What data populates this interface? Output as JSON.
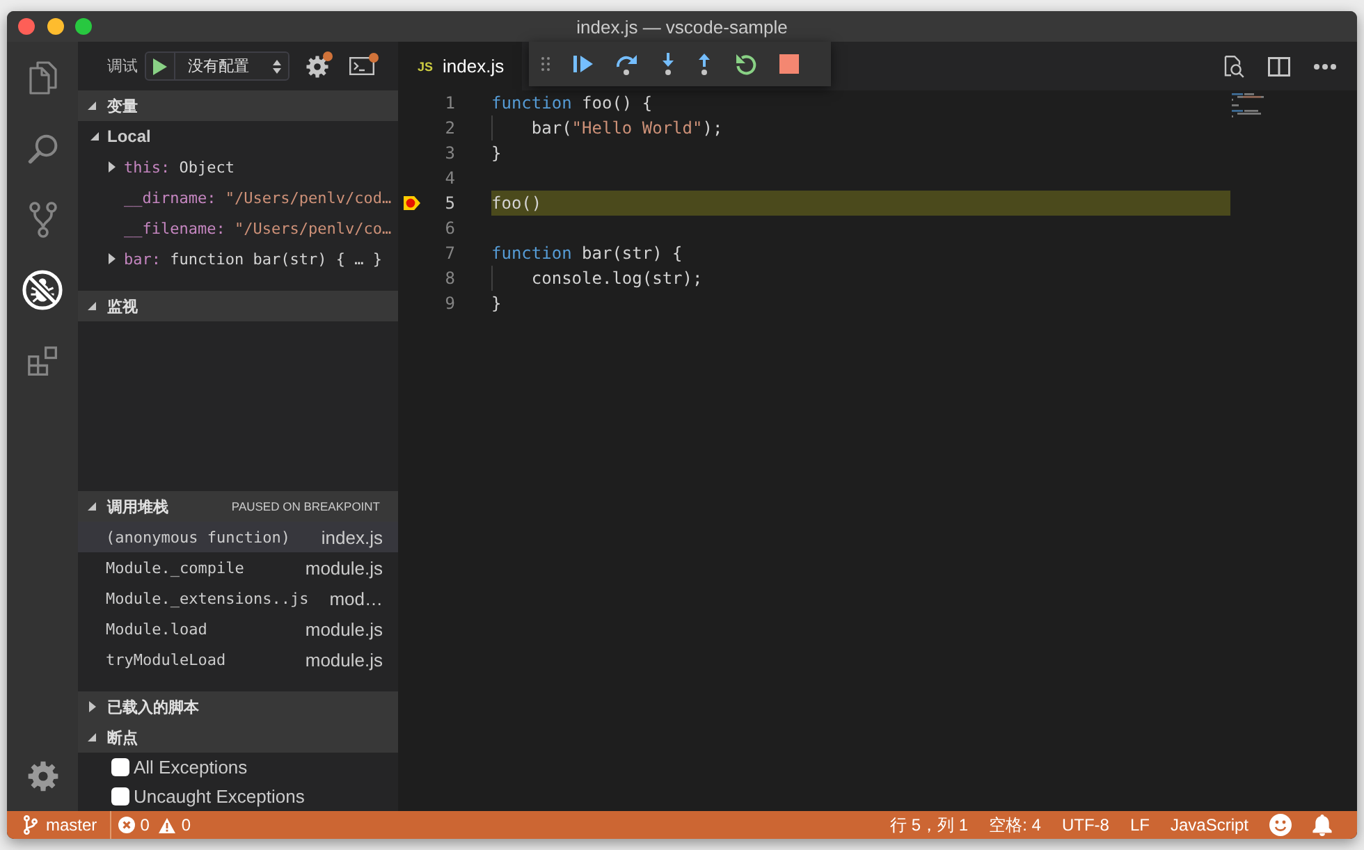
{
  "window": {
    "title": "index.js — vscode-sample"
  },
  "activity_bar": {
    "items": [
      {
        "kind": "files",
        "selected": false
      },
      {
        "kind": "search",
        "selected": false
      },
      {
        "kind": "source_control",
        "selected": false
      },
      {
        "kind": "debug",
        "selected": true
      },
      {
        "kind": "extensions",
        "selected": false
      }
    ]
  },
  "sidebar": {
    "title": "调试",
    "configuration": "没有配置",
    "sections": [
      {
        "kind": "variables",
        "title": "变量",
        "expanded": true,
        "scopes": [
          {
            "name": "Local",
            "expanded": true,
            "children": [
              {
                "kind": "object",
                "name": "this:",
                "value": "Object"
              },
              {
                "kind": "string",
                "name": "__dirname:",
                "value": "\"/Users/penlv/cod…"
              },
              {
                "kind": "string",
                "name": "__filename:",
                "value": "\"/Users/penlv/co…"
              },
              {
                "kind": "object",
                "name": "bar:",
                "value": "function bar(str) { … }"
              }
            ]
          }
        ]
      },
      {
        "kind": "watch",
        "title": "监视",
        "expanded": true
      },
      {
        "kind": "call_stack",
        "title": "调用堆栈",
        "expanded": true,
        "status": "PAUSED ON BREAKPOINT",
        "frames": [
          {
            "name": "(anonymous function)",
            "file": "index.js",
            "selected": true
          },
          {
            "name": "Module._compile",
            "file": "module.js",
            "selected": false
          },
          {
            "name": "Module._extensions..js",
            "file": "mod…",
            "selected": false
          },
          {
            "name": "Module.load",
            "file": "module.js",
            "selected": false
          },
          {
            "name": "tryModuleLoad",
            "file": "module.js",
            "selected": false
          }
        ]
      },
      {
        "title": "已载入的脚本",
        "expanded": false
      },
      {
        "kind": "breakpoints",
        "title": "断点",
        "expanded": true,
        "items": [
          {
            "label": "All Exceptions",
            "checked": false
          },
          {
            "label": "Uncaught Exceptions",
            "checked": false
          }
        ]
      }
    ]
  },
  "editor": {
    "tabs": [
      {
        "badge": "JS",
        "label": "index.js",
        "selected": true
      }
    ],
    "lines": [
      {
        "number": "1",
        "current": false,
        "breakpoint": false,
        "tokens": [
          {
            "kind": "keyword",
            "text": "function"
          },
          {
            "kind": "plain",
            "text": " foo() {"
          }
        ]
      },
      {
        "number": "2",
        "current": false,
        "breakpoint": false,
        "tokens": [
          {
            "kind": "plain",
            "text": "    bar("
          },
          {
            "kind": "string",
            "text": "\"Hello World\""
          },
          {
            "kind": "plain",
            "text": ");"
          }
        ]
      },
      {
        "number": "3",
        "current": false,
        "breakpoint": false,
        "tokens": [
          {
            "kind": "plain",
            "text": "}"
          }
        ]
      },
      {
        "number": "4",
        "current": false,
        "breakpoint": false
      },
      {
        "number": "5",
        "current": true,
        "breakpoint": true,
        "tokens": [
          {
            "kind": "plain",
            "text": "foo()"
          }
        ]
      },
      {
        "number": "6",
        "current": false,
        "breakpoint": false
      },
      {
        "number": "7",
        "current": false,
        "breakpoint": false,
        "tokens": [
          {
            "kind": "keyword",
            "text": "function"
          },
          {
            "kind": "plain",
            "text": " bar(str) {"
          }
        ]
      },
      {
        "number": "8",
        "current": false,
        "breakpoint": false,
        "tokens": [
          {
            "kind": "plain",
            "text": "    console.log(str);"
          }
        ]
      },
      {
        "number": "9",
        "current": false,
        "breakpoint": false,
        "tokens": [
          {
            "kind": "plain",
            "text": "}"
          }
        ]
      }
    ]
  },
  "status_bar": {
    "branch": "master",
    "errors": "0",
    "warnings": "0",
    "position": "行 5，列 1",
    "indentation": "空格: 4",
    "encoding": "UTF-8",
    "line_ending": "LF",
    "language": "JavaScript"
  }
}
